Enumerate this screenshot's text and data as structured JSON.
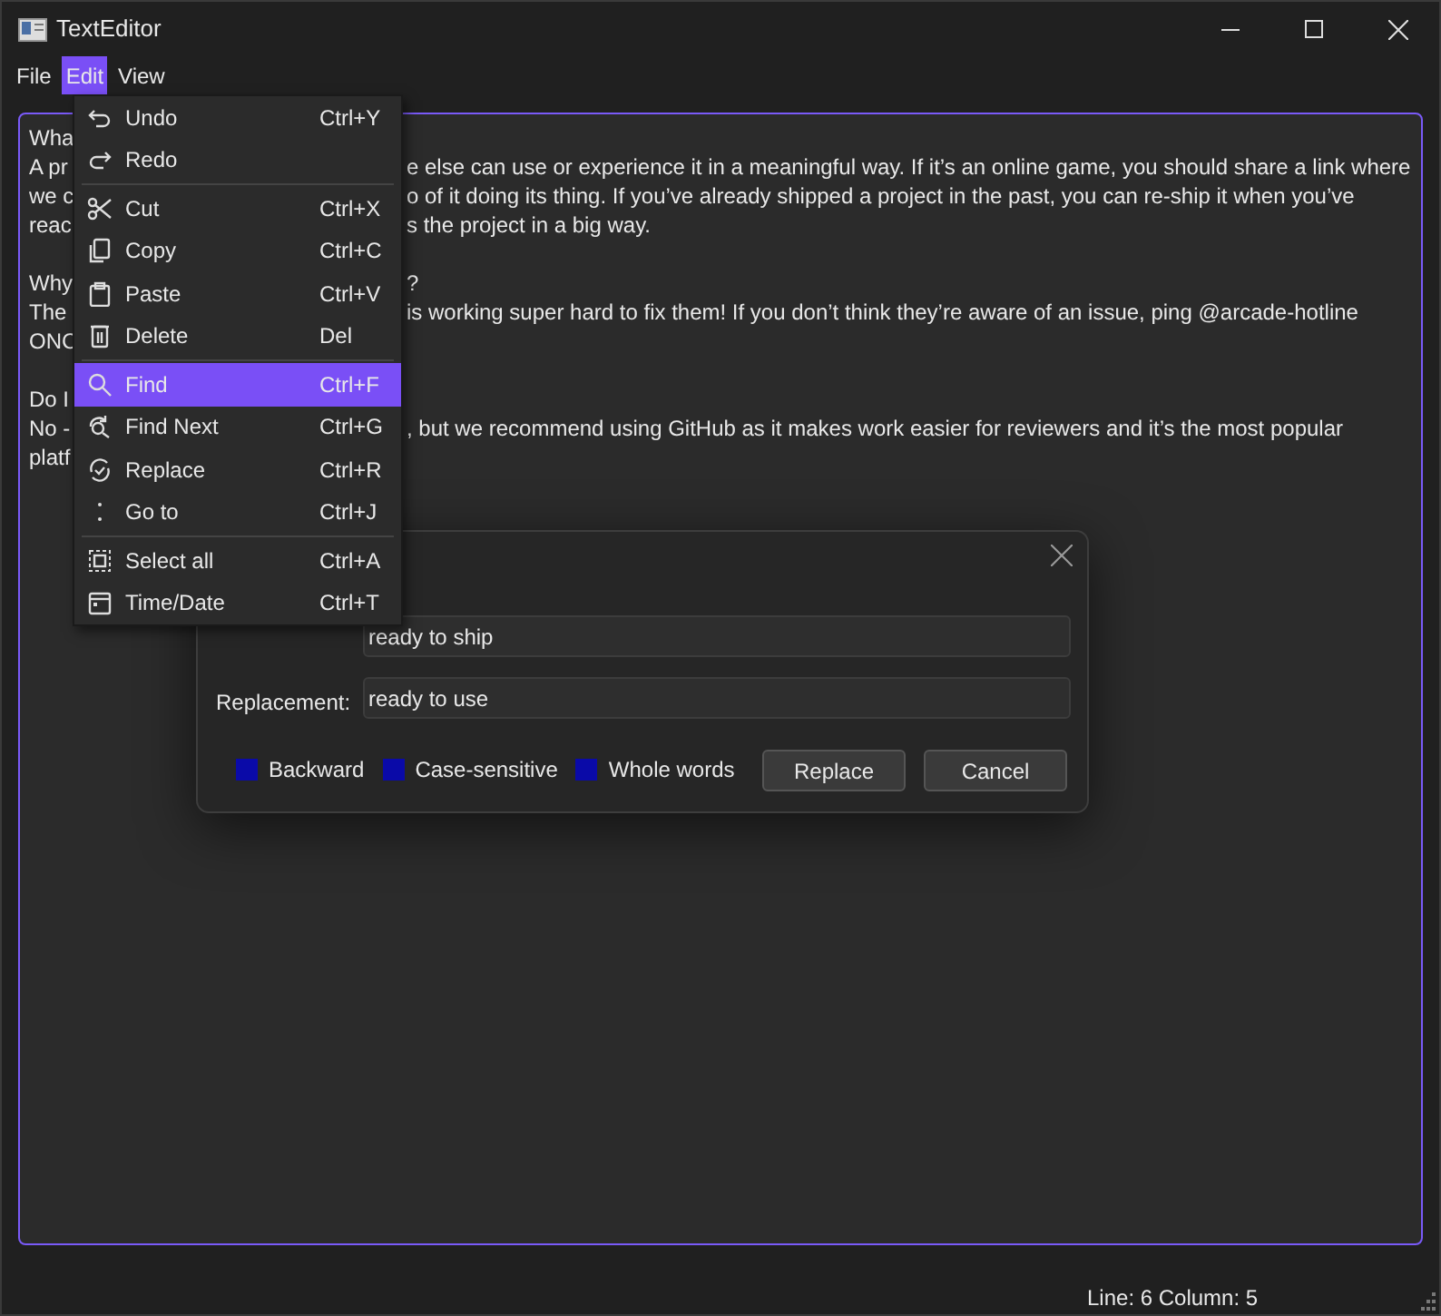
{
  "window": {
    "title": "TextEditor"
  },
  "menubar": [
    {
      "label": "File",
      "selected": false
    },
    {
      "label": "Edit",
      "selected": true
    },
    {
      "label": "View",
      "selected": false
    }
  ],
  "editor": {
    "lines": [
      {
        "start": "Wha"
      },
      {
        "start": "A pr",
        "end": "e else can use or experience it in a meaningful way. If it’s an online game, you should share a link where"
      },
      {
        "start": "we c",
        "end": "o of it doing its thing. If you’ve already shipped a project in the past, you can re-ship it when you’ve"
      },
      {
        "start": "reac",
        "end": "s the project in a big way."
      },
      {
        "start": "Why",
        "end": "?",
        "gap_before": true
      },
      {
        "start": "The",
        "end": "is working super hard to fix them! If you don’t think they’re aware of an issue, ping @arcade-hotline"
      },
      {
        "start": "ONC"
      },
      {
        "start": "Do I",
        "gap_before": true
      },
      {
        "start": "No -",
        "end": ", but we recommend using GitHub as it makes work easier for reviewers and it’s the most popular"
      },
      {
        "start": "platf"
      }
    ]
  },
  "edit_menu": [
    {
      "label": "Undo",
      "shortcut": "Ctrl+Y",
      "selected": false,
      "separator_after": false
    },
    {
      "label": "Redo",
      "selected": false,
      "separator_after": true
    },
    {
      "label": "Cut",
      "shortcut": "Ctrl+X",
      "selected": false,
      "separator_after": false
    },
    {
      "label": "Copy",
      "shortcut": "Ctrl+C",
      "selected": false,
      "separator_after": false
    },
    {
      "label": "Paste",
      "shortcut": "Ctrl+V",
      "selected": false,
      "separator_after": false
    },
    {
      "label": "Delete",
      "shortcut": "Del",
      "selected": false,
      "separator_after": true
    },
    {
      "label": "Find",
      "shortcut": "Ctrl+F",
      "selected": true,
      "separator_after": false
    },
    {
      "label": "Find Next",
      "shortcut": "Ctrl+G",
      "selected": false,
      "separator_after": false
    },
    {
      "label": "Replace",
      "shortcut": "Ctrl+R",
      "selected": false,
      "separator_after": false
    },
    {
      "label": "Go to",
      "shortcut": "Ctrl+J",
      "selected": false,
      "separator_after": true
    },
    {
      "label": "Select all",
      "shortcut": "Ctrl+A",
      "selected": false,
      "separator_after": false
    },
    {
      "label": "Time/Date",
      "shortcut": "Ctrl+T",
      "selected": false,
      "separator_after": false
    }
  ],
  "replace_dialog": {
    "find_value": "ready to ship",
    "replacement_label": "Replacement:",
    "replacement_value": "ready to use",
    "options": [
      {
        "label": "Backward",
        "checked": false
      },
      {
        "label": "Case-sensitive",
        "checked": false
      },
      {
        "label": "Whole words",
        "checked": false
      }
    ],
    "buttons": [
      "Replace",
      "Cancel"
    ]
  },
  "status_bar": {
    "position": "Line: 6 Column: 5"
  }
}
